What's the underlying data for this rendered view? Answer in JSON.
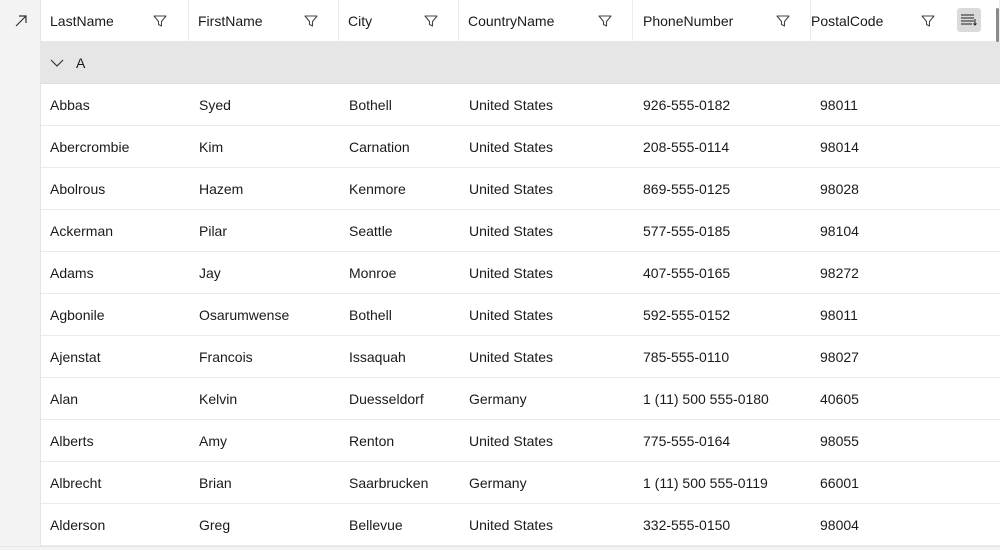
{
  "columns": [
    {
      "label": "LastName"
    },
    {
      "label": "FirstName"
    },
    {
      "label": "City"
    },
    {
      "label": "CountryName"
    },
    {
      "label": "PhoneNumber"
    },
    {
      "label": "PostalCode"
    }
  ],
  "group": {
    "label": "A",
    "expanded": true
  },
  "rows": [
    {
      "last": "Abbas",
      "first": "Syed",
      "city": "Bothell",
      "country": "United States",
      "phone": "926-555-0182",
      "postal": "98011"
    },
    {
      "last": "Abercrombie",
      "first": "Kim",
      "city": "Carnation",
      "country": "United States",
      "phone": "208-555-0114",
      "postal": "98014"
    },
    {
      "last": "Abolrous",
      "first": "Hazem",
      "city": "Kenmore",
      "country": "United States",
      "phone": "869-555-0125",
      "postal": "98028"
    },
    {
      "last": "Ackerman",
      "first": "Pilar",
      "city": "Seattle",
      "country": "United States",
      "phone": "577-555-0185",
      "postal": "98104"
    },
    {
      "last": "Adams",
      "first": "Jay",
      "city": "Monroe",
      "country": "United States",
      "phone": "407-555-0165",
      "postal": "98272"
    },
    {
      "last": "Agbonile",
      "first": "Osarumwense",
      "city": "Bothell",
      "country": "United States",
      "phone": "592-555-0152",
      "postal": "98011"
    },
    {
      "last": "Ajenstat",
      "first": "Francois",
      "city": "Issaquah",
      "country": "United States",
      "phone": "785-555-0110",
      "postal": "98027"
    },
    {
      "last": "Alan",
      "first": "Kelvin",
      "city": "Duesseldorf",
      "country": "Germany",
      "phone": "1 (11) 500 555-0180",
      "postal": "40605"
    },
    {
      "last": "Alberts",
      "first": "Amy",
      "city": "Renton",
      "country": "United States",
      "phone": "775-555-0164",
      "postal": "98055"
    },
    {
      "last": "Albrecht",
      "first": "Brian",
      "city": "Saarbrucken",
      "country": "Germany",
      "phone": "1 (11) 500 555-0119",
      "postal": "66001"
    },
    {
      "last": "Alderson",
      "first": "Greg",
      "city": "Bellevue",
      "country": "United States",
      "phone": "332-555-0150",
      "postal": "98004"
    }
  ],
  "icons": {
    "expand": "expand-arrow-icon",
    "filter": "funnel-icon",
    "chevron": "chevron-down-icon",
    "chooser": "column-chooser-icon"
  },
  "colors": {
    "header_bg": "#ffffff",
    "group_bg": "#e6e6e6",
    "indent_bg": "#f3f3f3",
    "chooser_bg": "#dadada",
    "text": "#1a1a1a"
  }
}
